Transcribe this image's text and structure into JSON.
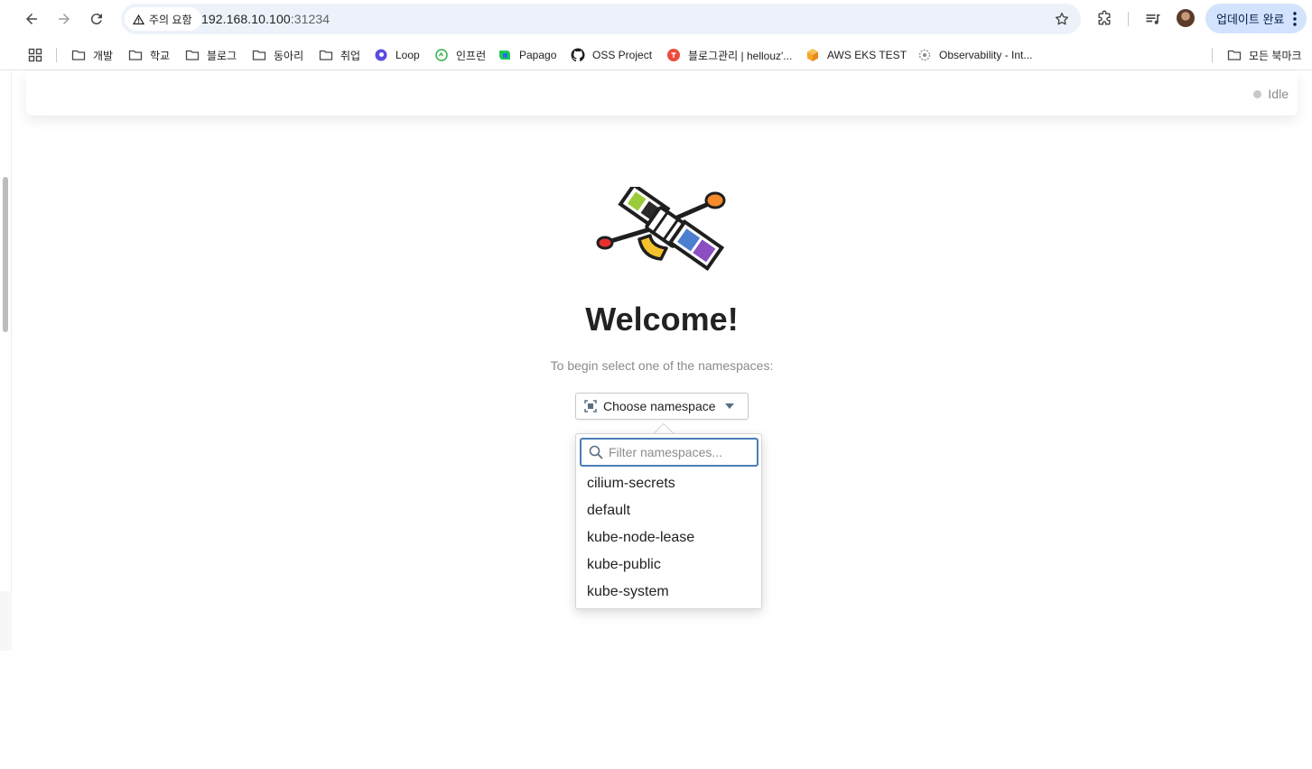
{
  "browser": {
    "security_label": "주의 요함",
    "url_host": "192.168.10.100",
    "url_port": ":31234",
    "update_label": "업데이트 완료"
  },
  "bookmarks": [
    {
      "label": "개발",
      "icon": "folder-icon"
    },
    {
      "label": "학교",
      "icon": "folder-icon"
    },
    {
      "label": "블로그",
      "icon": "folder-icon"
    },
    {
      "label": "동아리",
      "icon": "folder-icon"
    },
    {
      "label": "취업",
      "icon": "folder-icon"
    },
    {
      "label": "Loop",
      "icon": "loop-icon"
    },
    {
      "label": "인프런",
      "icon": "inflearn-icon"
    },
    {
      "label": "Papago",
      "icon": "papago-icon"
    },
    {
      "label": "OSS Project",
      "icon": "github-icon"
    },
    {
      "label": "블로그관리 | hellouz'...",
      "icon": "tistory-icon"
    },
    {
      "label": "AWS EKS TEST",
      "icon": "aws-cube-icon"
    },
    {
      "label": "Observability - Int...",
      "icon": "observability-icon"
    }
  ],
  "bookmarks_all_label": "모든 북마크",
  "status": {
    "label": "Idle",
    "color": "#c8c8c8"
  },
  "welcome": {
    "title": "Welcome!",
    "subtitle": "To begin select one of the namespaces:"
  },
  "namespace_button": {
    "label": "Choose namespace"
  },
  "filter": {
    "placeholder": "Filter namespaces...",
    "value": ""
  },
  "namespaces": [
    "cilium-secrets",
    "default",
    "kube-node-lease",
    "kube-public",
    "kube-system"
  ],
  "colors": {
    "accent": "#4a7db8",
    "update_bg": "#d3e3fd",
    "omnibox_bg": "#edf2fa"
  }
}
